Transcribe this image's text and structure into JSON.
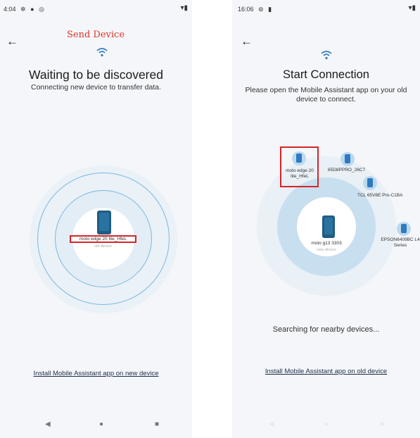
{
  "left": {
    "status": {
      "time": "4:04"
    },
    "annotation": "Send Device",
    "title": "Waiting to be discovered",
    "subtitle": "Connecting new device to transfer data.",
    "device": {
      "name": "moto edge 20 lite_HfeL",
      "role": "old device"
    },
    "link": "Install Mobile Assistant app on new device",
    "nav": {
      "back": "◀",
      "home": "●",
      "recents": "■"
    }
  },
  "right": {
    "status": {
      "time": "16:06"
    },
    "title": "Start Connection",
    "subtitle": "Please open the Mobile Assistant app on your old device to connect.",
    "center_device": {
      "name": "moto g13 3303",
      "role": "new device"
    },
    "nearby_devices": [
      {
        "name": "moto edge 20 lite_HfeL",
        "selected": true
      },
      {
        "name": "65D8PPRO_26C7"
      },
      {
        "name": "TCL 65V8E Pro-C1BA"
      },
      {
        "name": "EPSON6409BC L4 Series"
      }
    ],
    "searching": "Searching for nearby devices...",
    "link": "Install Mobile Assistant app on old device"
  },
  "colors": {
    "accent": "#2f7ac0",
    "highlight_box": "#d6252a",
    "annotation": "#e0352b"
  }
}
